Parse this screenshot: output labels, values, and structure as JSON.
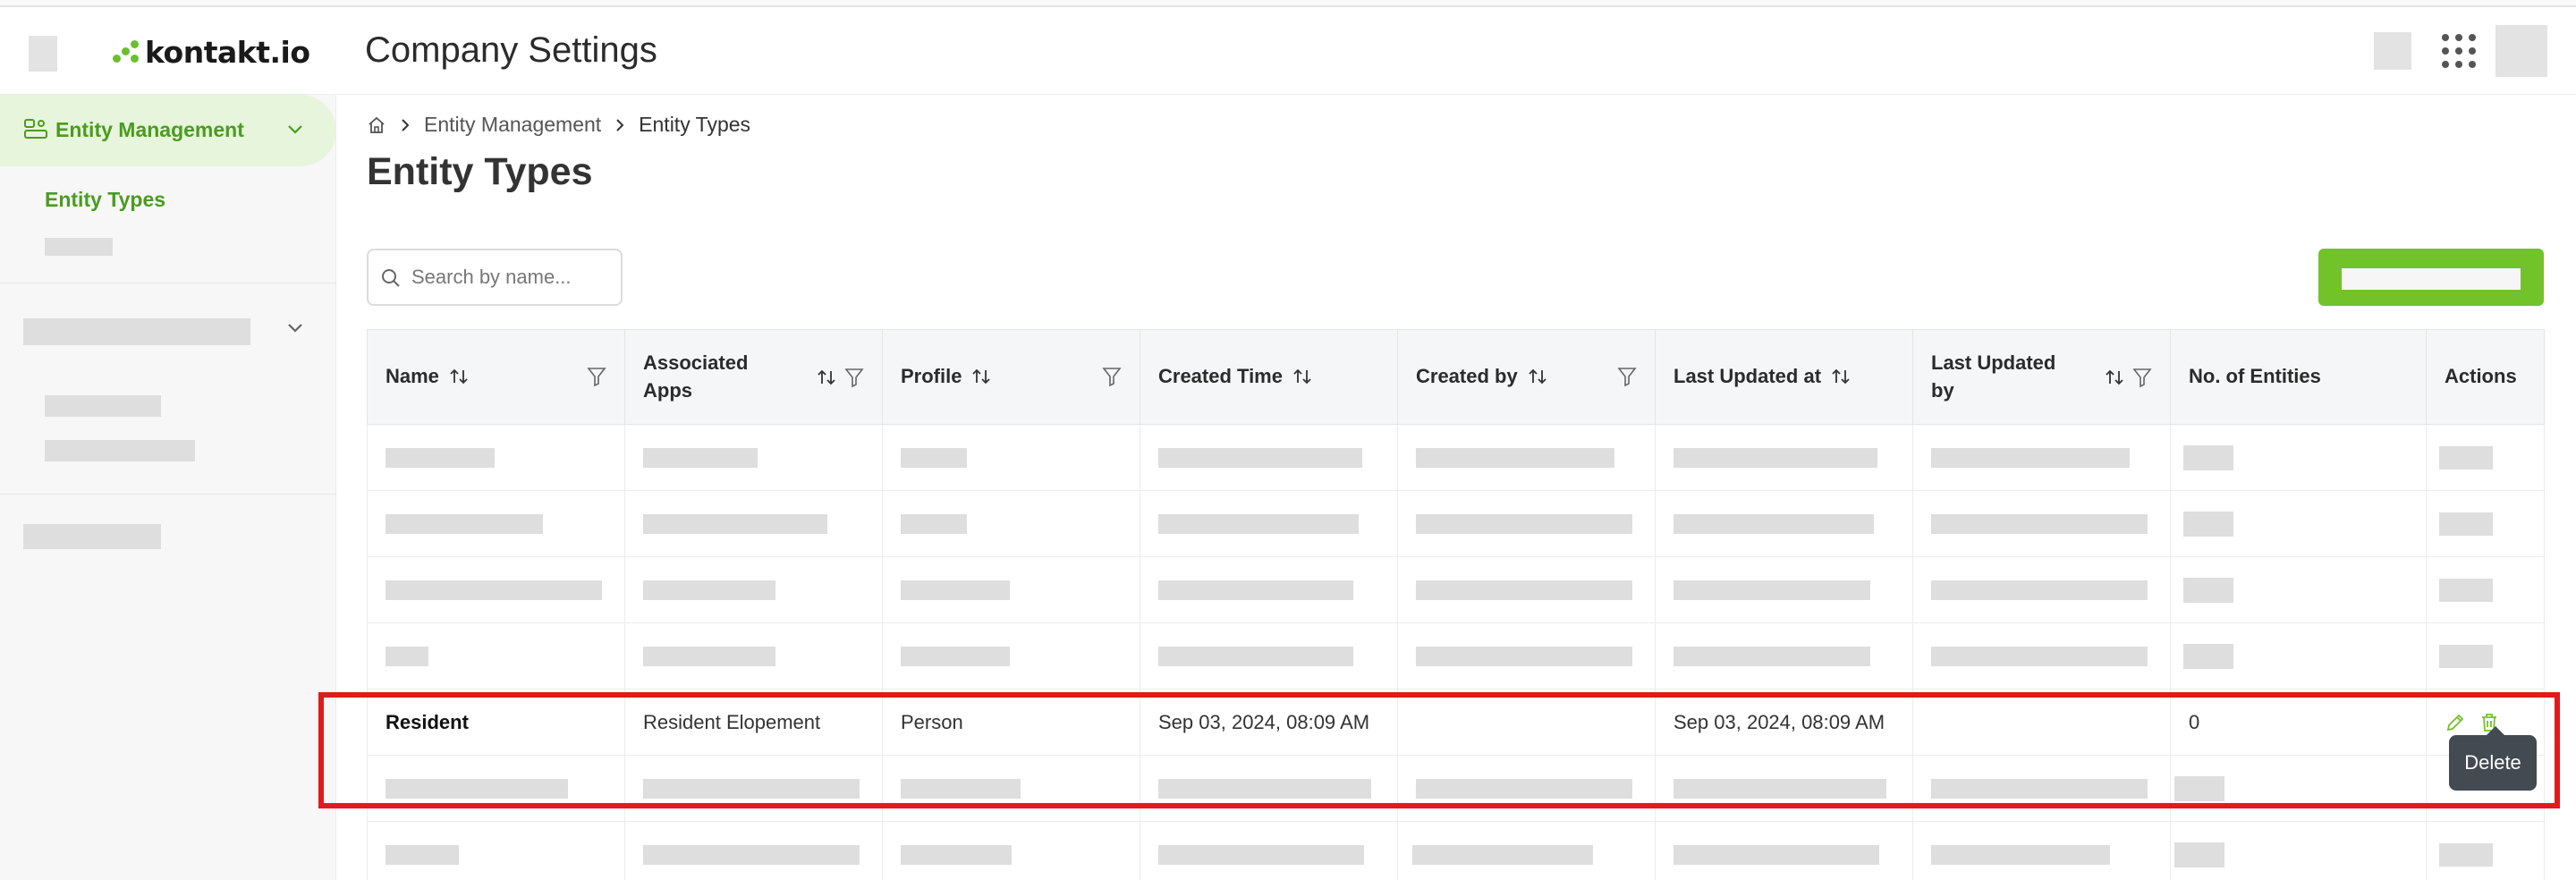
{
  "app": {
    "logo_text": "kontakt.io",
    "page_title": "Company Settings"
  },
  "sidebar": {
    "section_active": "Entity Management",
    "sub_active": "Entity Types"
  },
  "breadcrumb": {
    "home_icon": "home-icon",
    "items": [
      "Entity Management",
      "Entity Types"
    ]
  },
  "main": {
    "heading": "Entity Types",
    "search_placeholder": "Search by name..."
  },
  "table": {
    "columns": [
      {
        "label": "Name",
        "sortable": true,
        "filter": true
      },
      {
        "label": "Associated Apps",
        "sortable": true,
        "filter": true
      },
      {
        "label": "Profile",
        "sortable": true,
        "filter": true
      },
      {
        "label": "Created Time",
        "sortable": true,
        "filter": false
      },
      {
        "label": "Created by",
        "sortable": true,
        "filter": true
      },
      {
        "label": "Last Updated at",
        "sortable": true,
        "filter": false
      },
      {
        "label": "Last Updated by",
        "sortable": true,
        "filter": true
      },
      {
        "label": "No. of Entities",
        "sortable": false,
        "filter": false
      },
      {
        "label": "Actions",
        "sortable": false,
        "filter": false
      }
    ],
    "highlighted_row": {
      "name": "Resident",
      "associated_apps": "Resident Elopement",
      "profile": "Person",
      "created_time": "Sep 03, 2024, 08:09 AM",
      "created_by": "",
      "last_updated_at": "Sep 03, 2024, 08:09 AM",
      "last_updated_by": "",
      "entities": "0"
    }
  },
  "tooltip": {
    "text": "Delete"
  },
  "colors": {
    "brand_green": "#72c22a",
    "active_text": "#4a9c1e",
    "highlight_red": "#e01b1b"
  }
}
